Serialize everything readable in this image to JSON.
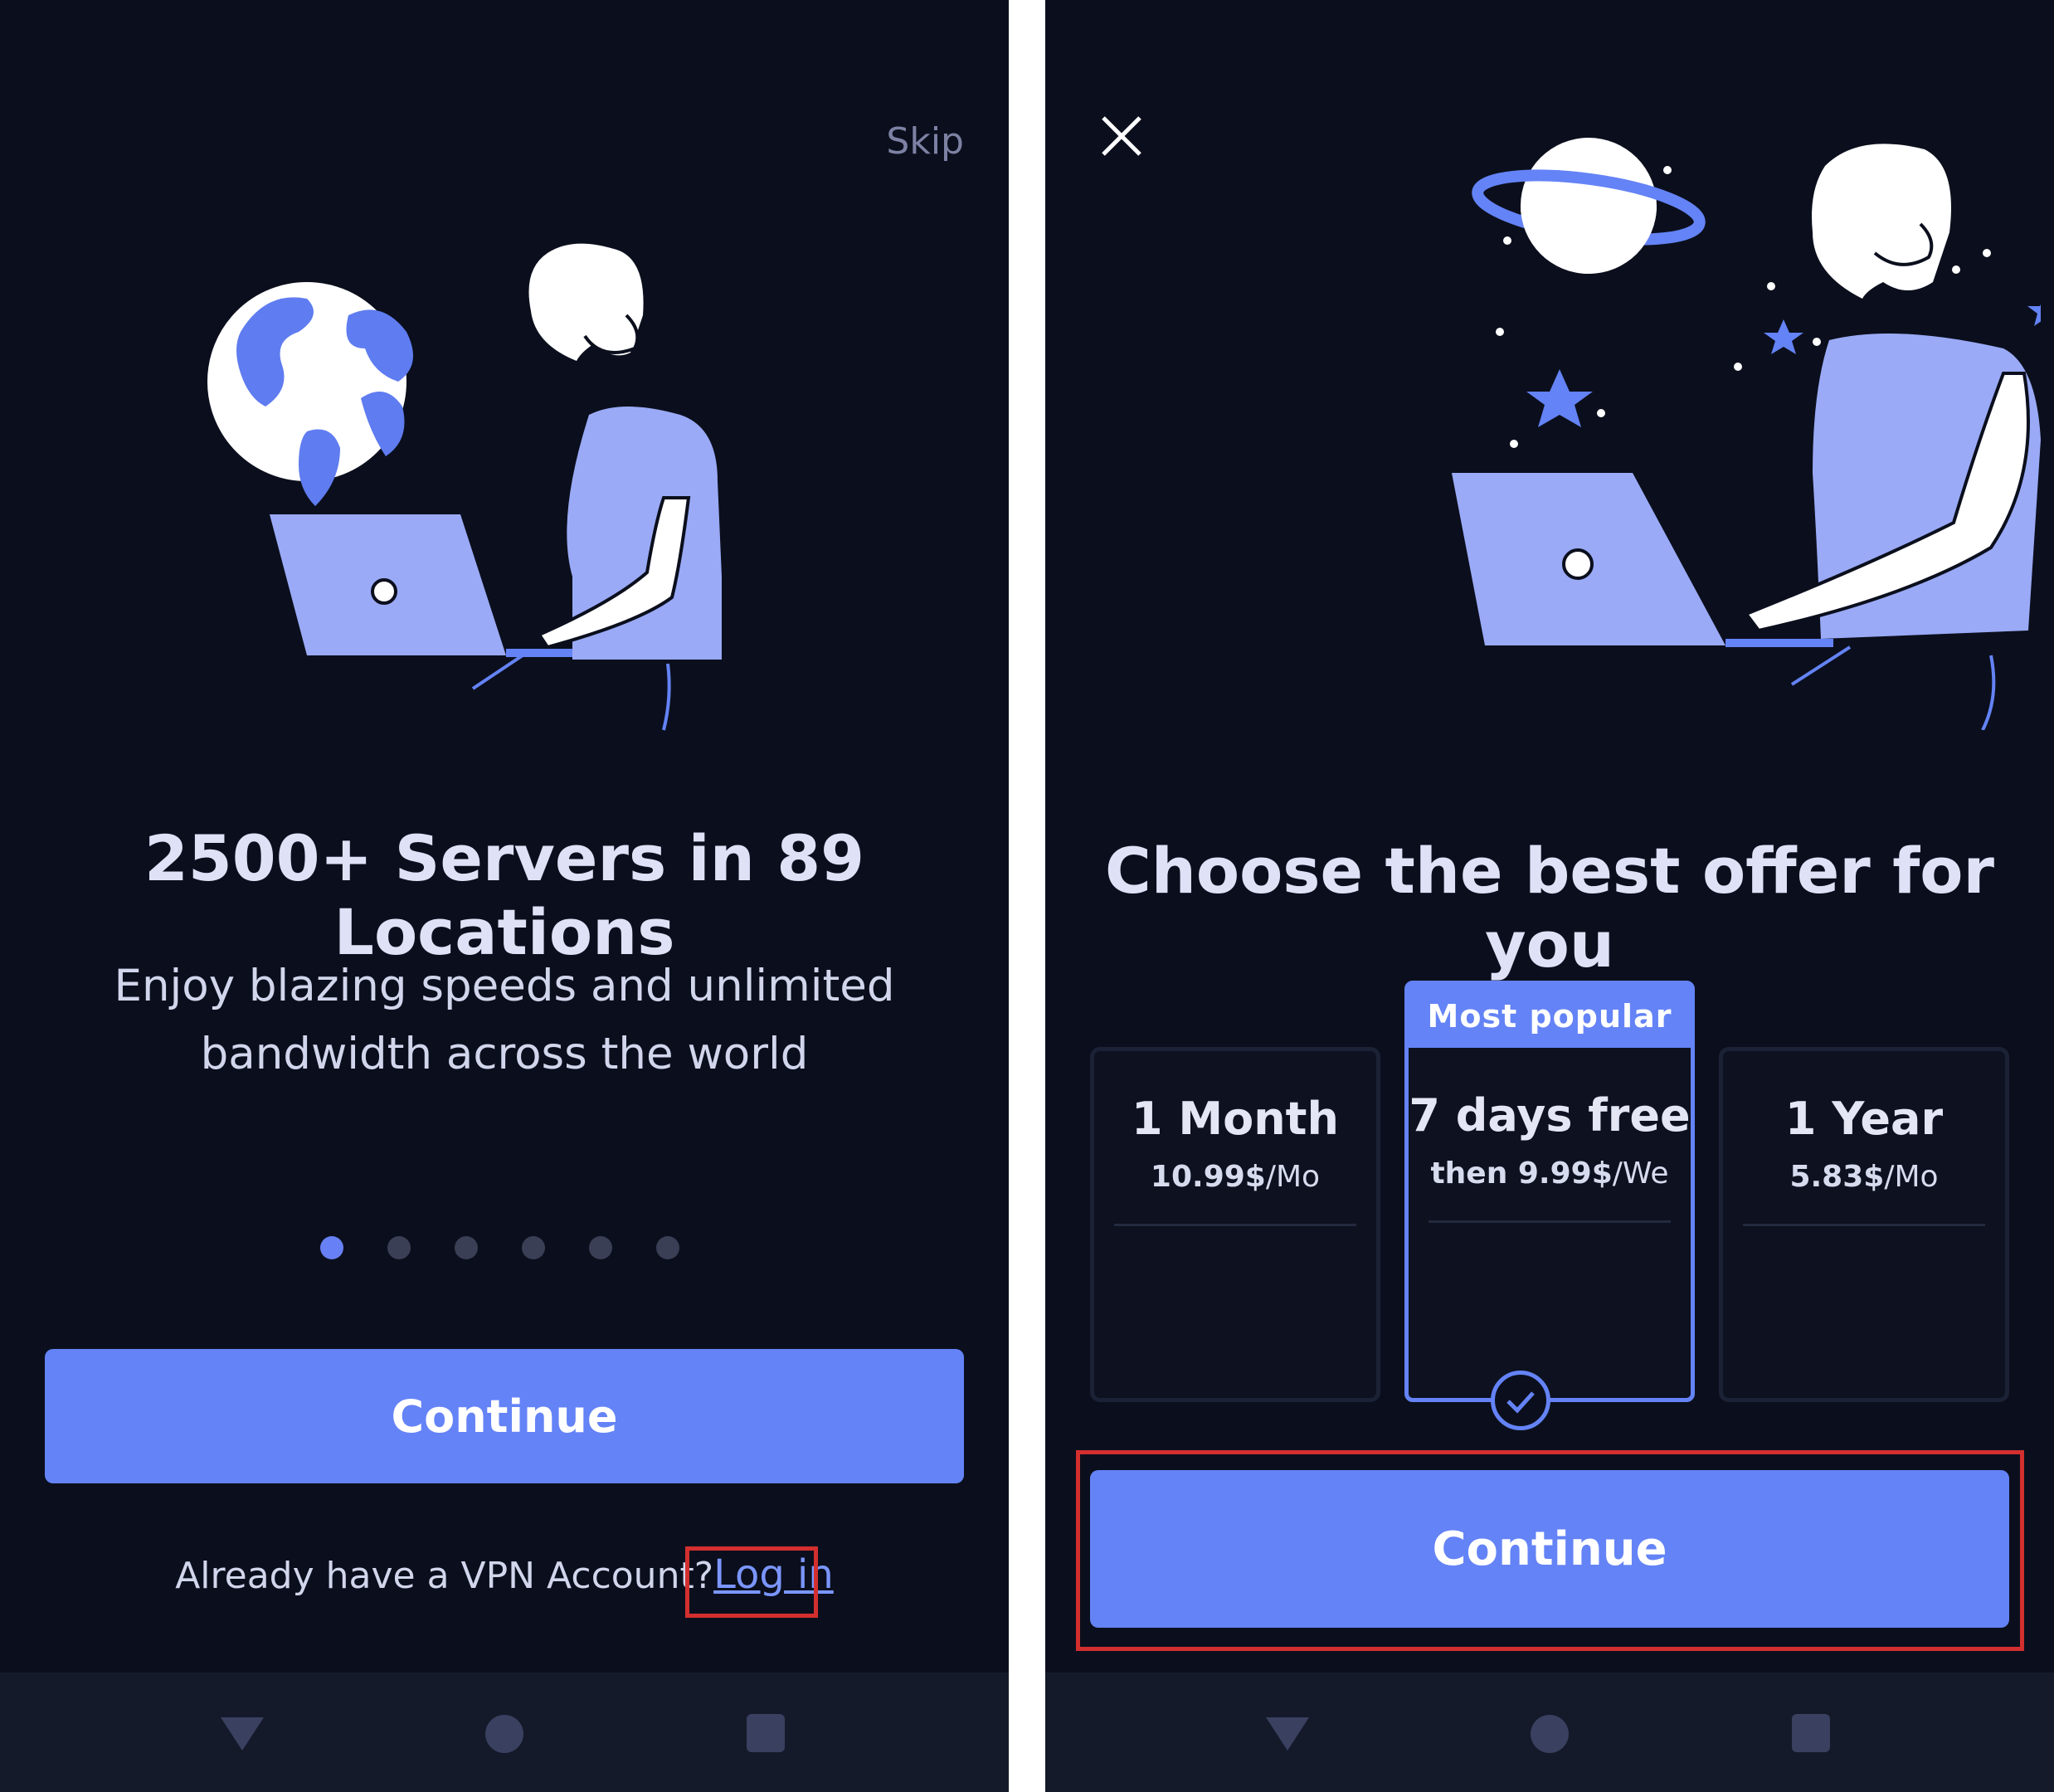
{
  "left_screen": {
    "skip_label": "Skip",
    "title": "2500+ Servers in 89 Locations",
    "subtitle_line1": "Enjoy blazing speeds and unlimited",
    "subtitle_line2": "bandwidth across the world",
    "pagination": {
      "total": 6,
      "active_index": 0
    },
    "continue_label": "Continue",
    "login_prompt": "Already have a VPN Account?",
    "login_link": "Log in"
  },
  "right_screen": {
    "title": "Choose the best offer for you",
    "plans": [
      {
        "name": "1 Month",
        "price_bold": "10.99$",
        "price_unit": "/Mo",
        "selected": false,
        "badge": ""
      },
      {
        "name": "7 days free",
        "price_bold": "then 9.99$",
        "price_unit": "/We",
        "selected": true,
        "badge": "Most popular"
      },
      {
        "name": "1 Year",
        "price_bold": "5.83$",
        "price_unit": "/Mo",
        "selected": false,
        "badge": ""
      }
    ],
    "continue_label": "Continue"
  },
  "icons": {
    "nav_back": "triangle-back-icon",
    "nav_home": "circle-home-icon",
    "nav_recent": "square-recents-icon",
    "close": "close-icon",
    "check": "check-icon"
  },
  "colors": {
    "background": "#0b0f1d",
    "accent": "#6483f6",
    "illustration_fill": "#9aaaf7",
    "highlight": "#d32f2f"
  }
}
